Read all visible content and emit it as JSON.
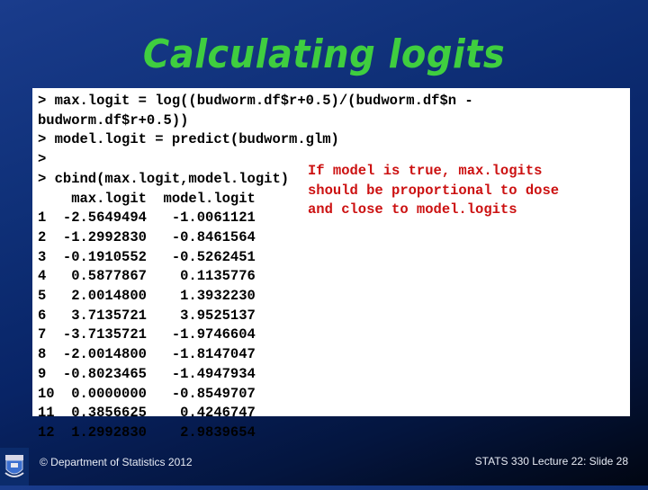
{
  "slide": {
    "title": "Calculating logits",
    "code_lines": [
      "> max.logit = log((budworm.df$r+0.5)/(budworm.df$n -",
      "budworm.df$r+0.5))",
      "> model.logit = predict(budworm.glm)",
      ">",
      "> cbind(max.logit,model.logit)"
    ],
    "table": {
      "headers": [
        "",
        "max.logit",
        "model.logit"
      ],
      "rows": [
        [
          "1",
          "-2.5649494",
          "-1.0061121"
        ],
        [
          "2",
          "-1.2992830",
          "-0.8461564"
        ],
        [
          "3",
          "-0.1910552",
          "-0.5262451"
        ],
        [
          "4",
          "0.5877867",
          "0.1135776"
        ],
        [
          "5",
          "2.0014800",
          "1.3932230"
        ],
        [
          "6",
          "3.7135721",
          "3.9525137"
        ],
        [
          "7",
          "-3.7135721",
          "-1.9746604"
        ],
        [
          "8",
          "-2.0014800",
          "-1.8147047"
        ],
        [
          "9",
          "-0.8023465",
          "-1.4947934"
        ],
        [
          "10",
          "0.0000000",
          "-0.8549707"
        ],
        [
          "11",
          "0.3856625",
          "0.4246747"
        ],
        [
          "12",
          "1.2992830",
          "2.9839654"
        ]
      ]
    },
    "note_lines": [
      "If model is true, max.logits",
      "should be proportional to dose",
      "and close to model.logits"
    ],
    "colors": {
      "title": "#3fce3f",
      "note": "#cc1111",
      "background": "#0b2b6b"
    }
  },
  "footer": {
    "copyright": "© Department of Statistics 2012",
    "slide_info": "STATS 330 Lecture 22: Slide 28",
    "logo": "university-crest-icon"
  }
}
